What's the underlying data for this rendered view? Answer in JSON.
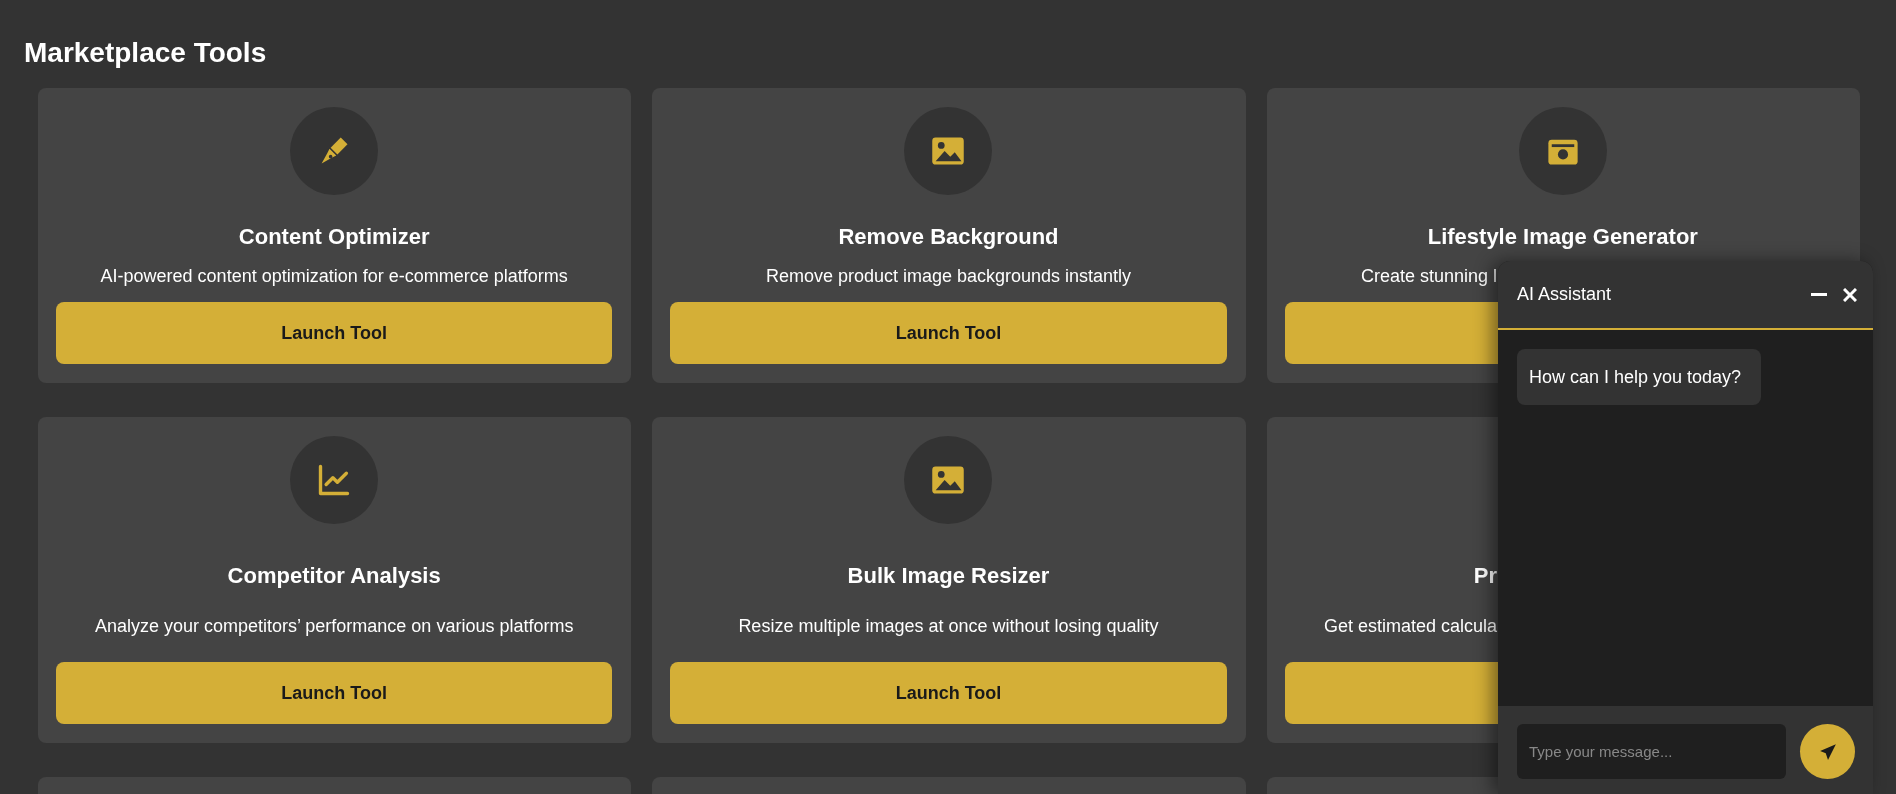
{
  "page_title": "Marketplace Tools",
  "cards": [
    {
      "kind": "full",
      "title": "Content Optimizer",
      "description": "AI-powered content optimization for e-commerce platforms",
      "button": "Launch Tool"
    },
    {
      "kind": "full",
      "title": "Remove Background",
      "description": "Remove product image backgrounds instantly",
      "button": "Launch Tool"
    },
    {
      "kind": "covered",
      "title": "Lifestyle Image Generator",
      "description": "Create stunning l"
    },
    {
      "kind": "full",
      "title": "Competitor Analysis",
      "description": "Analyze your competitors’ performance on various platforms",
      "button": "Launch Tool"
    },
    {
      "kind": "full",
      "title": "Bulk Image Resizer",
      "description": "Resize multiple images at once without losing quality",
      "button": "Launch Tool"
    },
    {
      "kind": "covered",
      "title": "Pr",
      "description": "Get estimated calcula"
    },
    {
      "kind": "edge"
    },
    {
      "kind": "edge"
    },
    {
      "kind": "edge"
    }
  ],
  "chat": {
    "title": "AI Assistant",
    "messages": [
      "How can I help you today?"
    ],
    "input": {
      "placeholder": "Type your message..."
    }
  }
}
